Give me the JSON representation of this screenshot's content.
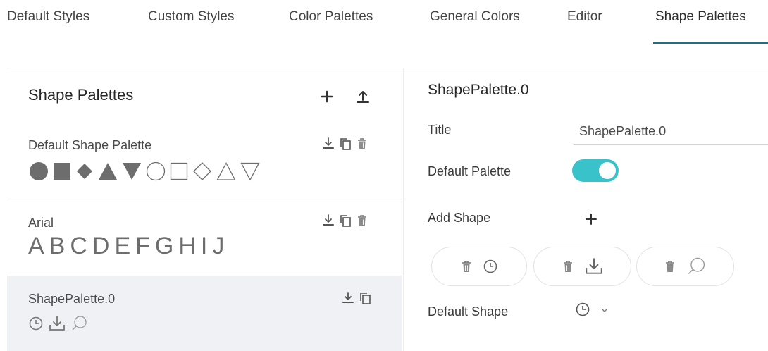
{
  "tabs": [
    {
      "label": "Default Styles"
    },
    {
      "label": "Custom Styles"
    },
    {
      "label": "Color Palettes"
    },
    {
      "label": "General Colors"
    },
    {
      "label": "Editor"
    },
    {
      "label": "Shape Palettes",
      "active": true
    }
  ],
  "left_panel": {
    "title": "Shape Palettes",
    "add_icon": "plus-icon",
    "upload_icon": "upload-icon",
    "palettes": [
      {
        "name": "Default Shape Palette",
        "shapes": [
          "filled-circle",
          "filled-square",
          "filled-diamond",
          "filled-triangle-up",
          "filled-triangle-down",
          "outline-circle",
          "outline-square",
          "outline-diamond",
          "outline-triangle-up",
          "outline-triangle-down"
        ],
        "actions": [
          "download-icon",
          "copy-icon",
          "trash-icon"
        ]
      },
      {
        "name": "Arial",
        "letters": "ABCDEFGHIJ",
        "actions": [
          "download-icon",
          "copy-icon",
          "trash-icon"
        ]
      },
      {
        "name": "ShapePalette.0",
        "shapes": [
          "clock-icon",
          "download-tray-icon",
          "search-icon"
        ],
        "actions": [
          "download-icon",
          "copy-icon"
        ],
        "selected": true
      }
    ]
  },
  "right_panel": {
    "title": "ShapePalette.0",
    "title_label": "Title",
    "title_value": "ShapePalette.0",
    "default_palette_label": "Default Palette",
    "default_palette_on": true,
    "add_shape_label": "Add Shape",
    "shapes": [
      "clock-icon",
      "download-tray-icon",
      "search-icon"
    ],
    "default_shape_label": "Default Shape",
    "default_shape_value": "clock-icon"
  },
  "colors": {
    "accent": "#1b6f86",
    "toggle": "#39c2c9",
    "selected_row": "#f0f1f5",
    "shape_fill": "#6d6d6d"
  }
}
